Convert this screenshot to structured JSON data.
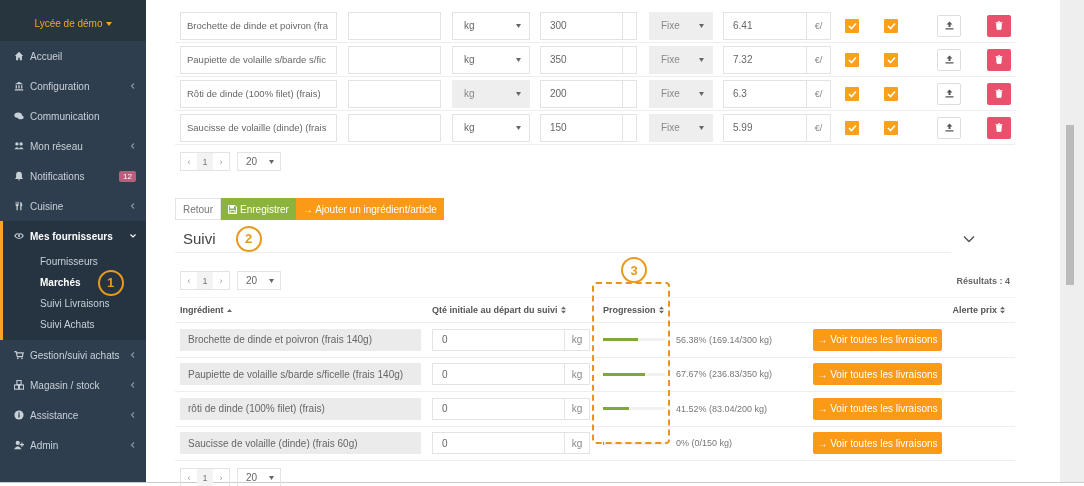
{
  "sidebar": {
    "school": "Lycée de démo",
    "items": [
      {
        "label": "Accueil"
      },
      {
        "label": "Configuration",
        "expanded": false
      },
      {
        "label": "Communication"
      },
      {
        "label": "Mon réseau",
        "expanded": false
      },
      {
        "label": "Notifications",
        "badge": "12"
      },
      {
        "label": "Cuisine",
        "expanded": false
      },
      {
        "label": "Mes fournisseurs",
        "expanded": true,
        "children": [
          {
            "label": "Fournisseurs",
            "selected": false
          },
          {
            "label": "Marchés",
            "selected": true,
            "callout": "1"
          },
          {
            "label": "Suivi Livraisons",
            "selected": false
          },
          {
            "label": "Suivi Achats",
            "selected": false
          }
        ]
      },
      {
        "label": "Gestion/suivi achats",
        "expanded": false
      },
      {
        "label": "Magasin / stock",
        "expanded": false
      },
      {
        "label": "Assistance",
        "expanded": false
      },
      {
        "label": "Admin",
        "expanded": false
      }
    ]
  },
  "market_items": {
    "rows": [
      {
        "name": "Brochette de dinde et poivron (fra",
        "unit": "kg",
        "unit_disabled": false,
        "quantity": "300",
        "price_type": "Fixe",
        "price": "6.41",
        "currency": "€/",
        "checked_1": true,
        "checked_2": true
      },
      {
        "name": "Paupiette de volaille s/barde s/fic",
        "unit": "kg",
        "unit_disabled": false,
        "quantity": "350",
        "price_type": "Fixe",
        "price": "7.32",
        "currency": "€/",
        "checked_1": true,
        "checked_2": true
      },
      {
        "name": "Rôti de dinde (100% filet) (frais)",
        "unit": "kg",
        "unit_disabled": true,
        "quantity": "200",
        "price_type": "Fixe",
        "price": "6.3",
        "currency": "€/",
        "checked_1": true,
        "checked_2": true
      },
      {
        "name": "Saucisse de volaille (dinde) (frais",
        "unit": "kg",
        "unit_disabled": false,
        "quantity": "150",
        "price_type": "Fixe",
        "price": "5.99",
        "currency": "€/",
        "checked_1": true,
        "checked_2": true
      }
    ],
    "pagination": {
      "prev": "‹",
      "page": "1",
      "next": "›",
      "per_page": "20"
    }
  },
  "actions": [
    {
      "label": "Retour",
      "kind": "plain"
    },
    {
      "label": "Enregistrer",
      "kind": "save"
    },
    {
      "label": "→ Ajouter un ingrédient/article",
      "kind": "add"
    }
  ],
  "tracking": {
    "title": "Suivi",
    "callout": "2",
    "expanded": true,
    "pagination_top": {
      "prev": "‹",
      "page": "1",
      "next": "›",
      "per_page": "20"
    },
    "results": "Résultats : 4",
    "columns": [
      {
        "label": "Ingrédient",
        "sorted_ascending": true
      },
      {
        "label": "Qté initiale au départ du suivi",
        "sorted_ascending": false
      },
      {
        "label": "Progression",
        "sorted_ascending": false,
        "callout": "3"
      },
      {
        "label": "Alerte prix",
        "sorted_ascending": false
      }
    ],
    "rows": [
      {
        "ingredient": "Brochette de dinde et poivron (frais 140g)",
        "initial_qty": "0",
        "unit": "kg",
        "level": 0.5638,
        "progress_text": "56.38% (169.14/300 kg)",
        "action": "→ Voir toutes les livraisons"
      },
      {
        "ingredient": "Paupiette de volaille s/barde s/ficelle (frais 140g)",
        "initial_qty": "0",
        "unit": "kg",
        "level": 0.6767,
        "progress_text": "67.67% (236.83/350 kg)",
        "action": "→ Voir toutes les livraisons"
      },
      {
        "ingredient": "rôti de dinde (100% filet) (frais)",
        "initial_qty": "0",
        "unit": "kg",
        "level": 0.4152,
        "progress_text": "41.52% (83.04/200 kg)",
        "action": "→ Voir toutes les livraisons"
      },
      {
        "ingredient": "Saucisse de volaille (dinde) (frais 60g)",
        "initial_qty": "0",
        "unit": "kg",
        "level": 0,
        "progress_text": "0% (0/150 kg)",
        "action": "→ Voir toutes les livraisons"
      }
    ],
    "pagination_bottom": {
      "prev": "‹",
      "page": "1",
      "next": "›",
      "per_page": "20"
    }
  }
}
